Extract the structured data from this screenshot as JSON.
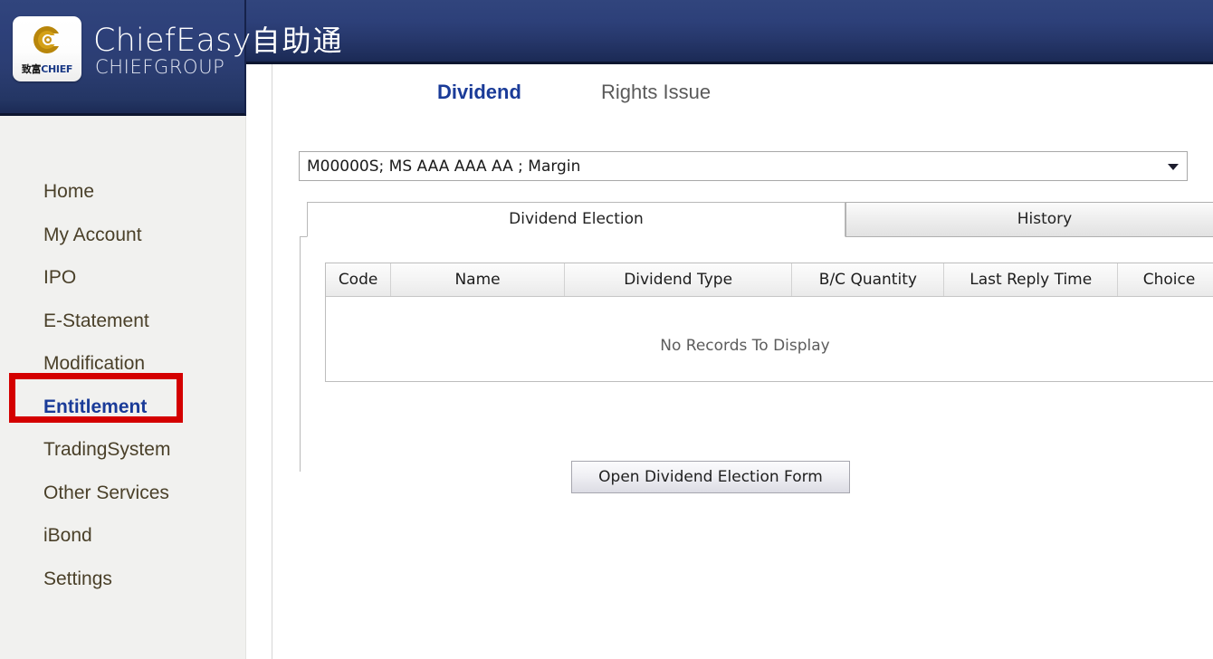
{
  "header": {
    "brand_title": "ChiefEasy",
    "brand_title_cjk": "自助通",
    "brand_sub": "CHIEFGROUP",
    "logo_cn": "致富",
    "logo_en": "CHIEF",
    "bg_color": "#2d4079"
  },
  "sidebar": {
    "items": [
      {
        "label": "Home",
        "active": false
      },
      {
        "label": "My Account",
        "active": false
      },
      {
        "label": "IPO",
        "active": false
      },
      {
        "label": "E-Statement",
        "active": false
      },
      {
        "label": "Modification",
        "active": false
      },
      {
        "label": "Entitlement",
        "active": true
      },
      {
        "label": "TradingSystem",
        "active": false
      },
      {
        "label": "Other Services",
        "active": false
      },
      {
        "label": "iBond",
        "active": false
      },
      {
        "label": "Settings",
        "active": false
      }
    ],
    "highlight_color": "#d40000",
    "active_color": "#1a3b98"
  },
  "main": {
    "tabs": [
      {
        "label": "Dividend",
        "active": true
      },
      {
        "label": "Rights Issue",
        "active": false
      }
    ],
    "account_select": {
      "value": "M00000S; MS AAA AAA AA ; Margin",
      "arrow": "chevron-down-icon"
    },
    "sub_tabs": [
      {
        "label": "Dividend Election",
        "active": true
      },
      {
        "label": "History",
        "active": false
      }
    ],
    "grid": {
      "columns": [
        "Code",
        "Name",
        "Dividend Type",
        "B/C Quantity",
        "Last Reply Time",
        "Choice"
      ],
      "rows": [],
      "empty_message": "No Records To Display"
    },
    "open_form_button": "Open Dividend Election Form"
  }
}
